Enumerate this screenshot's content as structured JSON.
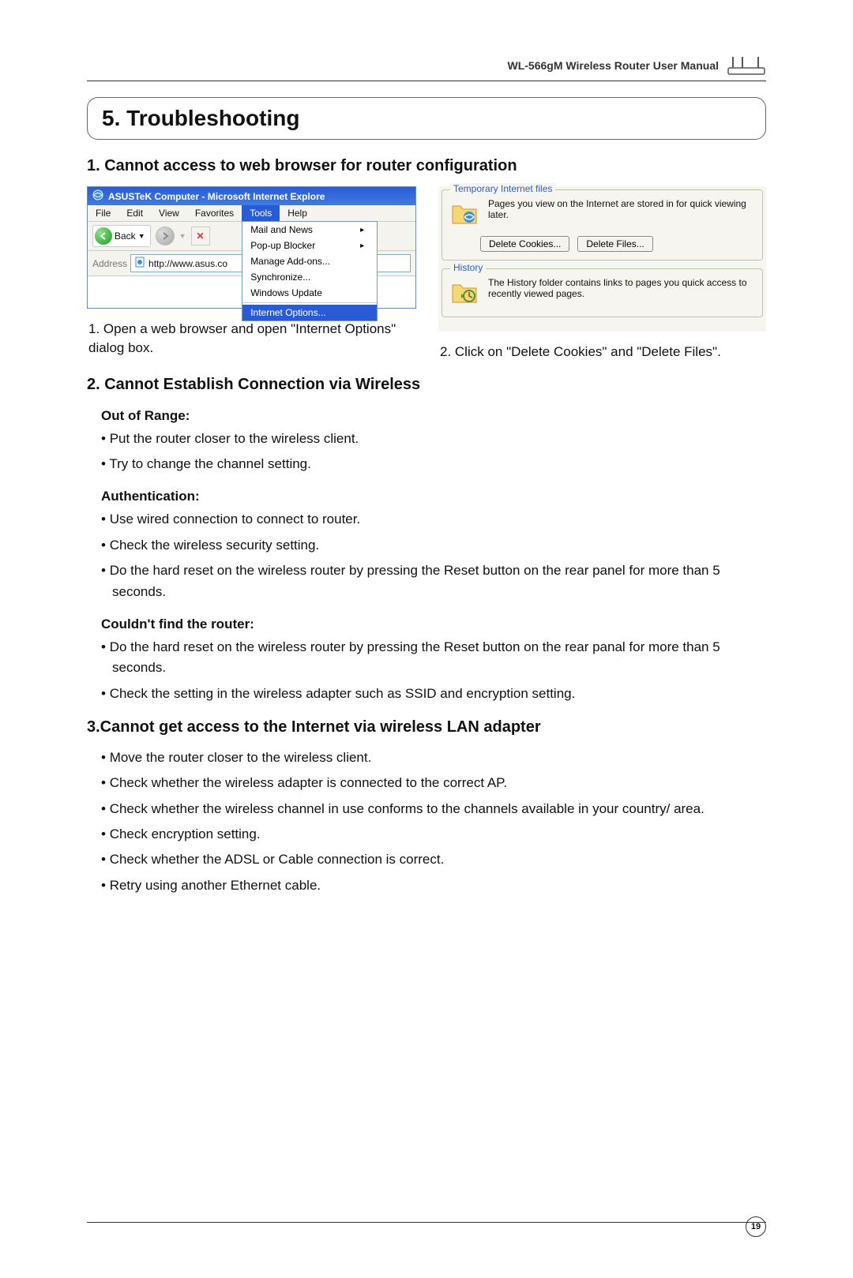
{
  "header": {
    "manual_title": "WL-566gM Wireless Router User Manual"
  },
  "chapter": {
    "title": "5. Troubleshooting"
  },
  "section1": {
    "title": "1. Cannot access to web browser for router  configuration",
    "caption_left": "1. Open a web browser and open \"Internet Options\" dialog box.",
    "caption_right": "2. Click on \"Delete Cookies\" and \"Delete Files\"."
  },
  "ie": {
    "title": "ASUSTeK Computer - Microsoft Internet Explore",
    "menu": {
      "file": "File",
      "edit": "Edit",
      "view": "View",
      "favorites": "Favorites",
      "tools": "Tools",
      "help": "Help"
    },
    "back": "Back",
    "address_label": "Address",
    "address_value": "http://www.asus.co",
    "tools_menu": {
      "mail": "Mail and News",
      "popup": "Pop-up Blocker",
      "addons": "Manage Add-ons...",
      "sync": "Synchronize...",
      "update": "Windows Update",
      "options": "Internet Options..."
    }
  },
  "options_panel": {
    "group1_label": "Temporary Internet files",
    "group1_text": "Pages you view on the Internet are stored in for quick viewing later.",
    "btn_cookies": "Delete Cookies...",
    "btn_files": "Delete Files...",
    "group2_label": "History",
    "group2_text": "The History folder contains links to pages you quick access to recently viewed pages."
  },
  "section2": {
    "title": "2. Cannot Establish Connection via Wireless",
    "sub1": "Out of Range:",
    "sub1_items": [
      "Put the router closer to the wireless client.",
      "Try to change the channel setting."
    ],
    "sub2": "Authentication:",
    "sub2_items": [
      "Use wired connection to connect to router.",
      "Check the wireless security setting.",
      "Do the hard reset on the wireless router by pressing the Reset button on the rear panel for more than 5 seconds."
    ],
    "sub3": "Couldn't find the router:",
    "sub3_items": [
      "Do the hard reset on the wireless router by pressing the Reset button on the rear panal for more than 5 seconds.",
      "Check the setting in the wireless adapter such as SSID and encryption setting."
    ]
  },
  "section3": {
    "title": "3.Cannot get access to the Internet via wireless LAN adapter",
    "items": [
      "Move the router closer to the wireless client.",
      "Check whether the wireless adapter is connected to the correct AP.",
      "Check whether the wireless channel in use conforms to the channels available in your country/ area.",
      "Check encryption setting.",
      "Check whether the ADSL or Cable connection is correct.",
      "Retry using another Ethernet cable."
    ]
  },
  "page_number": "19"
}
